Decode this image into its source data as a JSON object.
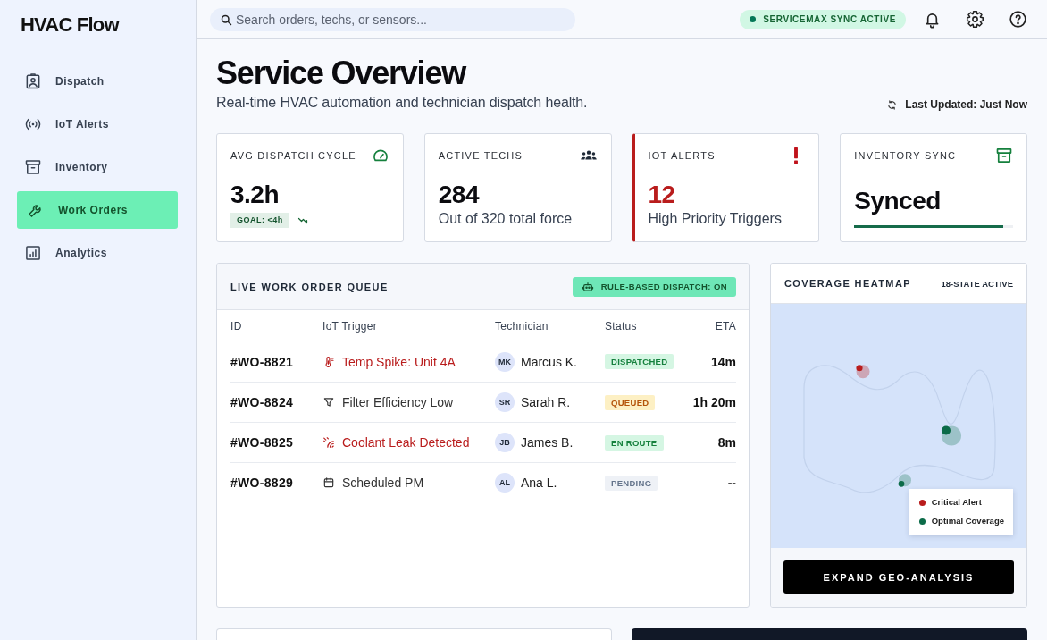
{
  "sidebar": {
    "logo": "HVAC Flow",
    "items": [
      {
        "label": "Dispatch",
        "selected": false
      },
      {
        "label": "IoT Alerts",
        "selected": false
      },
      {
        "label": "Inventory",
        "selected": false
      },
      {
        "label": "Work Orders",
        "selected": true
      },
      {
        "label": "Analytics",
        "selected": false
      }
    ]
  },
  "topbar": {
    "search": {
      "placeholder": "Search orders, techs, or sensors..."
    },
    "sync_badge": "SERVICEMAX SYNC ACTIVE"
  },
  "header": {
    "title": "Service Overview",
    "subtitle": "Real-time HVAC automation and technician dispatch health.",
    "last_updated": "Last Updated: Just Now"
  },
  "stats": [
    {
      "kind": "goal",
      "label": "AVG DISPATCH CYCLE",
      "value": "3.2h",
      "goal": "GOAL: <4h"
    },
    {
      "kind": "count",
      "label": "ACTIVE TECHS",
      "value": "284",
      "caption": "Out of 320 total force"
    },
    {
      "kind": "alert",
      "label": "IOT ALERTS",
      "value": "12",
      "caption": "High Priority Triggers"
    },
    {
      "kind": "sync",
      "label": "INVENTORY SYNC",
      "value": "Synced",
      "level": 0.94
    }
  ],
  "queue": {
    "title": "LIVE WORK ORDER QUEUE",
    "badge": "RULE-BASED DISPATCH: ON",
    "columns": [
      "ID",
      "IoT Trigger",
      "Technician",
      "Status",
      "ETA"
    ],
    "rows": [
      {
        "id": "#WO-8821",
        "trigger": {
          "text": "Temp Spike: Unit 4A",
          "kind": "temperature",
          "alert": true
        },
        "initials": "MK",
        "technician": "Marcus K.",
        "status": {
          "label": "DISPATCHED",
          "kind": "dispatched"
        },
        "eta": "14m"
      },
      {
        "id": "#WO-8824",
        "trigger": {
          "text": "Filter Efficiency Low",
          "kind": "filter",
          "alert": false
        },
        "initials": "SR",
        "technician": "Sarah R.",
        "status": {
          "label": "QUEUED",
          "kind": "queued"
        },
        "eta": "1h 20m"
      },
      {
        "id": "#WO-8825",
        "trigger": {
          "text": "Coolant Leak Detected",
          "kind": "leak",
          "alert": true
        },
        "initials": "JB",
        "technician": "James B.",
        "status": {
          "label": "EN ROUTE",
          "kind": "en_route"
        },
        "eta": "8m"
      },
      {
        "id": "#WO-8829",
        "trigger": {
          "text": "Scheduled PM",
          "kind": "scheduled",
          "alert": false
        },
        "initials": "AL",
        "technician": "Ana L.",
        "status": {
          "label": "PENDING",
          "kind": "pending"
        },
        "eta": "--"
      }
    ]
  },
  "heatmap": {
    "title": "COVERAGE HEATMAP",
    "badge": "18-STATE ACTIVE",
    "legend": [
      {
        "label": "Critical Alert",
        "color": "#b91c1c"
      },
      {
        "label": "Optimal Coverage",
        "color": "#0b6b48"
      }
    ],
    "button": "EXPAND GEO-ANALYSIS"
  }
}
